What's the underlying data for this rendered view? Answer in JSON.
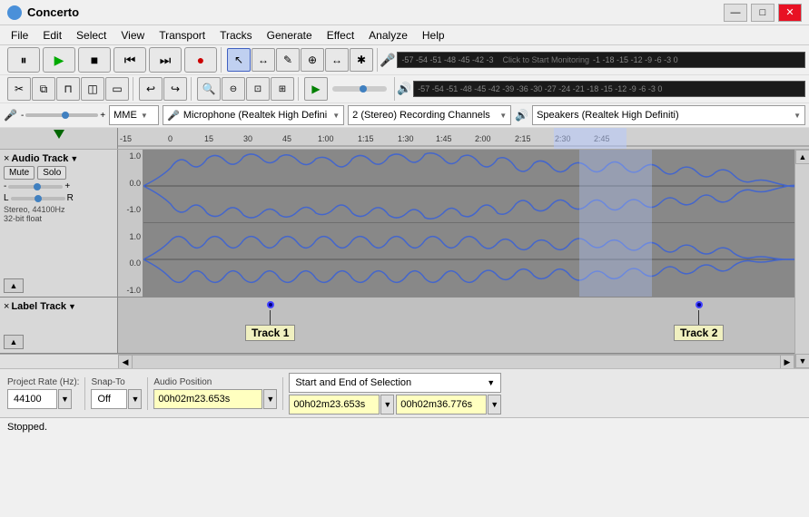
{
  "app": {
    "title": "Concerto",
    "icon": "♪"
  },
  "titlebar": {
    "minimize": "—",
    "maximize": "□",
    "close": "✕"
  },
  "menu": {
    "items": [
      "File",
      "Edit",
      "Select",
      "View",
      "Transport",
      "Tracks",
      "Generate",
      "Effect",
      "Analyze",
      "Help"
    ]
  },
  "toolbar": {
    "transport": {
      "pause": "⏸",
      "play": "▶",
      "stop": "■",
      "skip_start": "⏮",
      "skip_end": "⏭",
      "record": "●"
    },
    "tools": [
      "↖",
      "↔",
      "✎",
      "🔊",
      "⊕",
      "✱"
    ],
    "edit": {
      "cut": "✂",
      "copy": "⧉",
      "paste": "📋",
      "trim": "◫",
      "silence": "—",
      "undo": "↩",
      "redo": "↪"
    },
    "zoom": {
      "zoom_in": "🔍+",
      "zoom_out": "🔍−",
      "zoom_sel": "⊡",
      "zoom_fit": "⊞",
      "play_btn": "▶",
      "loop": "↻"
    }
  },
  "meters": {
    "input_label": "Click to Start Monitoring",
    "input_scale": "-57 -54 -51 -48 -45 -42 -3",
    "output_scale": "-57 -54 -51 -48 -45 -42 -39 -36 -30 -27 -24 -21 -18 -15 -12 -9 -6 -3 0",
    "db_levels_top": [
      "-57",
      "-54",
      "-51",
      "-48",
      "-45",
      "-42",
      "Click to Start Monitoring",
      "-1",
      "-18",
      "-15",
      "-12",
      "-9",
      "-6",
      "-3",
      "0"
    ],
    "db_levels_bottom": [
      "-57",
      "-54",
      "-51",
      "-48",
      "-45",
      "-42",
      "-39",
      "-36",
      "-30",
      "-27",
      "-24",
      "-21",
      "-18",
      "-15",
      "-12",
      "-9",
      "-6",
      "-3",
      "0"
    ]
  },
  "dropdowns": {
    "audio_host": "MME",
    "mic": "Microphone (Realtek High Defini",
    "channels": "2 (Stereo) Recording Channels",
    "speaker": "Speakers (Realtek High Definiti)"
  },
  "timeline": {
    "markers": [
      "-15",
      "0",
      "15",
      "30",
      "45",
      "1:00",
      "1:15",
      "1:30",
      "1:45",
      "2:00",
      "2:15",
      "2:30",
      "2:45"
    ]
  },
  "tracks": {
    "audio_track": {
      "name": "Audio Track",
      "close": "×",
      "mute": "Mute",
      "solo": "Solo",
      "gain_minus": "-",
      "gain_plus": "+",
      "pan_l": "L",
      "pan_r": "R",
      "info": "Stereo, 44100Hz\n32-bit float",
      "info1": "Stereo, 44100Hz",
      "info2": "32-bit float",
      "y_labels_top": [
        "1.0",
        "0.0",
        "-1.0"
      ],
      "y_labels_bottom": [
        "1.0",
        "0.0",
        "-1.0"
      ]
    },
    "label_track": {
      "name": "Label Track",
      "close": "×",
      "label1": "Track 1",
      "label2": "Track 2"
    }
  },
  "bottom_bar": {
    "project_rate_label": "Project Rate (Hz):",
    "project_rate": "44100",
    "snap_to_label": "Snap-To",
    "snap_to": "Off",
    "audio_position_label": "Audio Position",
    "audio_position": "0 0 h 0 2 m 2 3 . 6 5 3 s",
    "audio_position_val": "00h02m23.653s",
    "selection_label": "Start and End of Selection",
    "sel_start": "00h02m23.653s",
    "sel_end": "00h02m36.776s"
  },
  "statusbar": {
    "text": "Stopped."
  }
}
